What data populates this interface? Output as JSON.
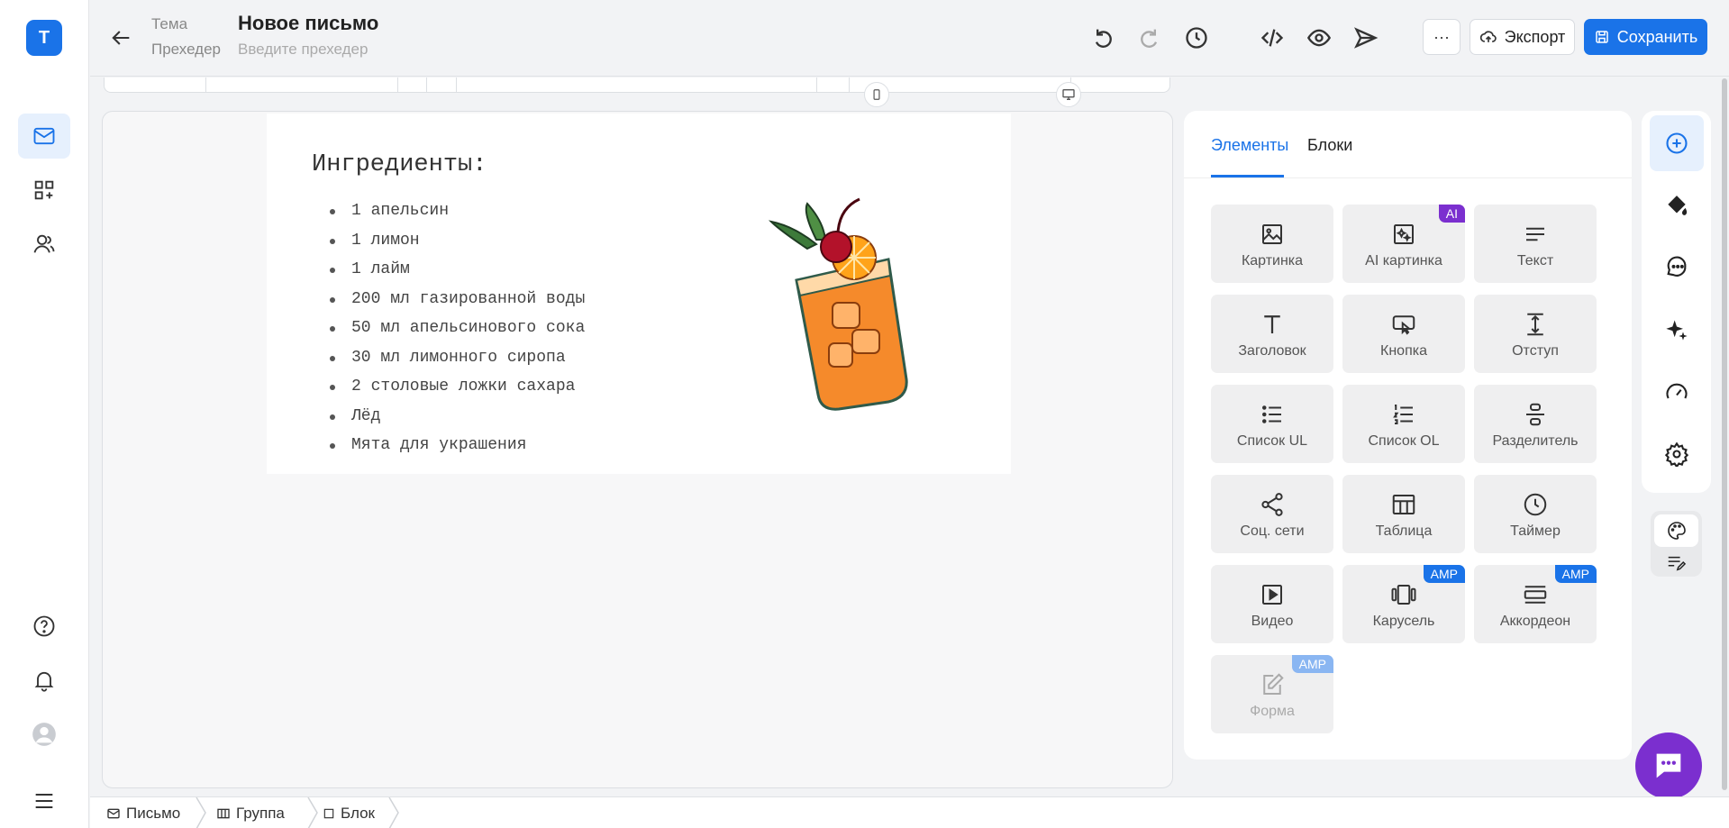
{
  "app": {
    "logo_letter": "T"
  },
  "header": {
    "theme_label": "Тема",
    "preheader_label": "Прехедер",
    "title": "Новое письмо",
    "preheader_placeholder": "Введите прехедер",
    "more_label": "···",
    "export_label": "Экспорт",
    "save_label": "Сохранить"
  },
  "email": {
    "heading": "Ингредиенты:",
    "items": [
      "1 апельсин",
      "1 лимон",
      "1 лайм",
      "200 мл газированной воды",
      "50 мл апельсинового сока",
      "30 мл лимонного сиропа",
      "2 столовые ложки сахара",
      "Лёд",
      "Мята для украшения"
    ]
  },
  "panel": {
    "tabs": [
      "Элементы",
      "Блоки"
    ],
    "active_tab": 0,
    "tiles": [
      {
        "label": "Картинка",
        "icon": "image-icon"
      },
      {
        "label": "AI картинка",
        "icon": "ai-image-icon",
        "badge": "AI"
      },
      {
        "label": "Текст",
        "icon": "text-icon"
      },
      {
        "label": "Заголовок",
        "icon": "heading-icon"
      },
      {
        "label": "Кнопка",
        "icon": "button-icon"
      },
      {
        "label": "Отступ",
        "icon": "spacer-icon"
      },
      {
        "label": "Список UL",
        "icon": "list-ul-icon"
      },
      {
        "label": "Список OL",
        "icon": "list-ol-icon"
      },
      {
        "label": "Разделитель",
        "icon": "divider-icon"
      },
      {
        "label": "Соц. сети",
        "icon": "share-icon"
      },
      {
        "label": "Таблица",
        "icon": "table-icon"
      },
      {
        "label": "Таймер",
        "icon": "clock-icon"
      },
      {
        "label": "Видео",
        "icon": "video-icon"
      },
      {
        "label": "Карусель",
        "icon": "carousel-icon",
        "badge": "AMP"
      },
      {
        "label": "Аккордеон",
        "icon": "accordion-icon",
        "badge": "AMP"
      },
      {
        "label": "Форма",
        "icon": "form-icon",
        "badge": "AMP",
        "disabled": true
      }
    ]
  },
  "breadcrumbs": [
    "Письмо",
    "Группа",
    "Блок"
  ],
  "colors": {
    "accent": "#1a73e8",
    "ai_badge": "#7b2fcf",
    "chat": "#7b2fcf"
  }
}
